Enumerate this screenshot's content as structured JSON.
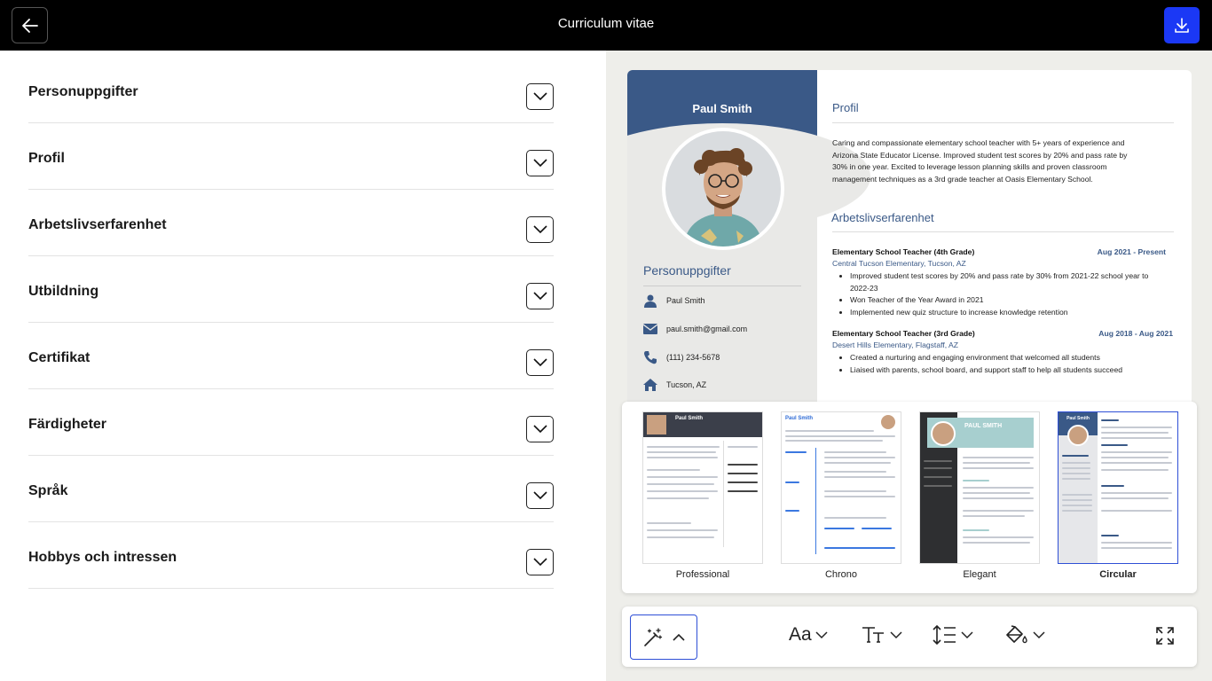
{
  "header": {
    "title": "Curriculum vitae"
  },
  "sections": [
    {
      "label": "Personuppgifter"
    },
    {
      "label": "Profil"
    },
    {
      "label": "Arbetslivserfarenhet"
    },
    {
      "label": "Utbildning"
    },
    {
      "label": "Certifikat"
    },
    {
      "label": "Färdigheter"
    },
    {
      "label": "Språk"
    },
    {
      "label": "Hobbys och intressen"
    }
  ],
  "resume": {
    "name": "Paul Smith",
    "personal_heading": "Personuppgifter",
    "contact": {
      "name": "Paul Smith",
      "email": "paul.smith@gmail.com",
      "phone": "(111) 234-5678",
      "location": "Tucson, AZ"
    },
    "profile_heading": "Profil",
    "profile_text": "Caring and compassionate elementary school teacher with 5+ years of experience and Arizona State Educator License. Improved student test scores by 20% and pass rate by 30% in one year. Excited to leverage lesson planning skills and proven classroom management techniques as a 3rd grade teacher at Oasis Elementary School.",
    "work_heading": "Arbetslivserfarenhet",
    "jobs": [
      {
        "title": "Elementary School Teacher (4th Grade)",
        "date": "Aug 2021 - Present",
        "company": "Central Tucson Elementary, Tucson, AZ",
        "bullets": [
          "Improved student test scores by 20% and pass rate by 30% from 2021-22 school year to 2022-23",
          "Won Teacher of the Year Award in 2021",
          "Implemented new quiz structure to increase knowledge retention"
        ]
      },
      {
        "title": "Elementary School Teacher (3rd Grade)",
        "date": "Aug 2018 - Aug 2021",
        "company": "Desert Hills Elementary, Flagstaff, AZ",
        "bullets": [
          "Created a nurturing and engaging environment that welcomed all students",
          "Liaised with parents, school board, and support staff to help all students succeed"
        ]
      }
    ]
  },
  "templates": [
    {
      "name": "Professional",
      "selected": false
    },
    {
      "name": "Chrono",
      "selected": false
    },
    {
      "name": "Elegant",
      "selected": false
    },
    {
      "name": "Circular",
      "selected": true
    }
  ],
  "thumb_text": {
    "professional_name": "Paul Smith",
    "chrono_name": "Paul Smith",
    "elegant_name": "PAUL SMITH",
    "circular_name": "Paul Smith"
  },
  "toolbar": {
    "font_label": "Aa"
  },
  "colors": {
    "accent_blue": "#1b38f5",
    "resume_navy": "#3a5987",
    "selection_blue": "#2e4fd6"
  }
}
